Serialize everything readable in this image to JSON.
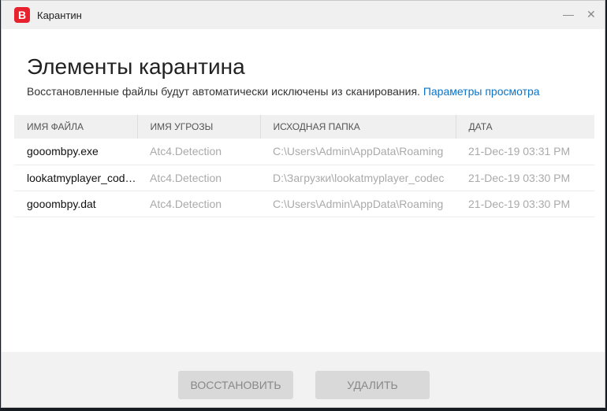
{
  "window": {
    "title": "Карантин",
    "logo": "B",
    "minimize": "—",
    "close": "✕"
  },
  "page": {
    "title": "Элементы карантина",
    "subtitle": "Восстановленные файлы будут автоматически исключены из сканирования.",
    "link": "Параметры просмотра"
  },
  "table": {
    "headers": [
      "ИМЯ ФАЙЛА",
      "ИМЯ УГРОЗЫ",
      "ИСХОДНАЯ ПАПКА",
      "ДАТА"
    ],
    "rows": [
      [
        "gooombpy.exe",
        "Atc4.Detection",
        "C:\\Users\\Admin\\AppData\\Roaming",
        "21-Dec-19 03:31 PM"
      ],
      [
        "lookatmyplayer_codec.exe",
        "Atc4.Detection",
        "D:\\Загрузки\\lookatmyplayer_codec",
        "21-Dec-19 03:30 PM"
      ],
      [
        "gooombpy.dat",
        "Atc4.Detection",
        "C:\\Users\\Admin\\AppData\\Roaming",
        "21-Dec-19 03:30 PM"
      ]
    ]
  },
  "footer": {
    "restore": "ВОССТАНОВИТЬ",
    "delete": "УДАЛИТЬ"
  }
}
